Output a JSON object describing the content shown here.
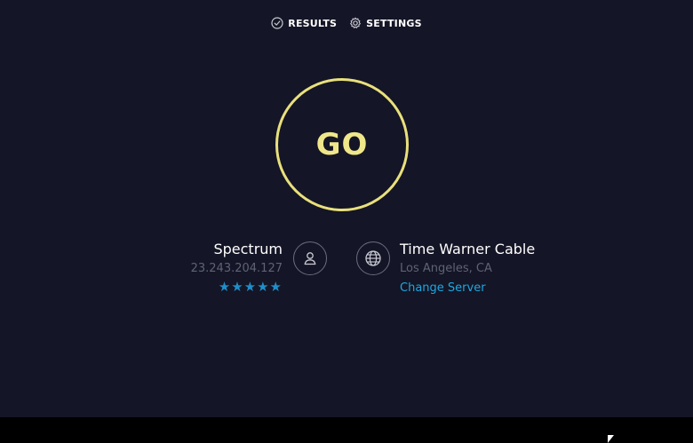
{
  "nav": {
    "results_label": "RESULTS",
    "settings_label": "SETTINGS"
  },
  "go_button": {
    "label": "GO"
  },
  "isp": {
    "name": "Spectrum",
    "ip": "23.243.204.127",
    "stars": "★★★★★",
    "rating": 5
  },
  "server": {
    "name": "Time Warner Cable",
    "location": "Los Angeles, CA",
    "change_label": "Change Server"
  },
  "colors": {
    "background": "#141526",
    "go_ring": "#e9e07c",
    "star": "#1f8ec9",
    "link": "#1fa7e0",
    "muted": "#5f6375"
  },
  "icons": {
    "results": "check-circle-icon",
    "settings": "gear-icon",
    "user": "user-icon",
    "globe": "globe-icon"
  }
}
